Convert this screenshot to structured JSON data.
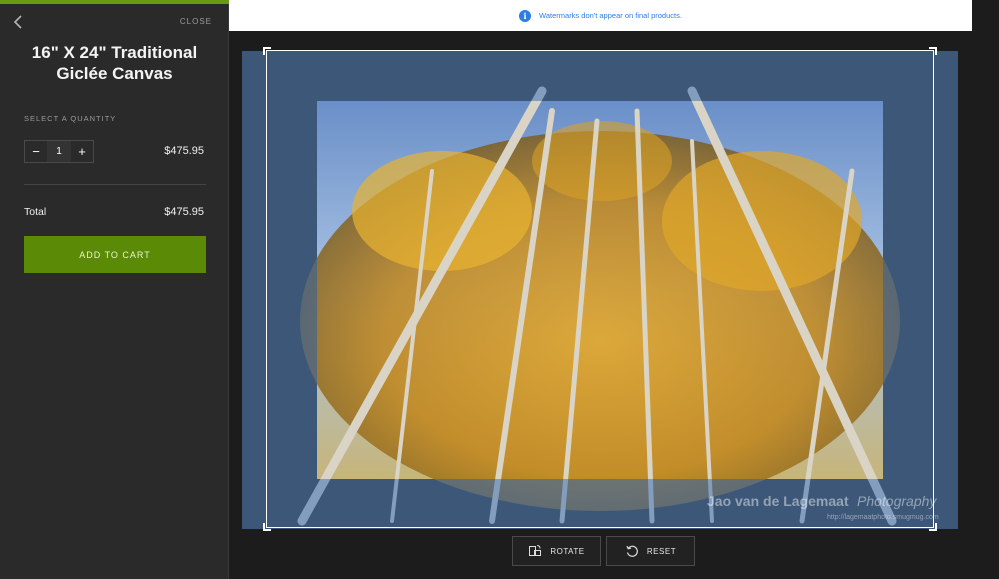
{
  "sidebar": {
    "progress_fraction": 1.0,
    "close_label": "CLOSE",
    "product_title_line1": "16\" X 24\" Traditional",
    "product_title_line2": "Giclée Canvas",
    "quantity_label": "SELECT A QUANTITY",
    "quantity": {
      "decrement": "−",
      "value": "1",
      "increment": "+"
    },
    "unit_price": "$475.95",
    "total_label": "Total",
    "total_value": "$475.95",
    "add_to_cart_label": "ADD TO CART"
  },
  "main": {
    "info_icon": "i",
    "info_text": "Watermarks don't appear on final products.",
    "watermark_name": "Jao van de Lagemaat",
    "watermark_brand": "Photography",
    "watermark_url": "http://lagemaatphoto.smugmug.com",
    "rotate_label": "ROTATE",
    "reset_label": "RESET"
  },
  "colors": {
    "accent_green": "#5a8a06",
    "info_blue": "#2b7de9"
  },
  "icons": [
    "chevron-left-icon",
    "info-icon",
    "rotate-icon",
    "reset-icon"
  ]
}
